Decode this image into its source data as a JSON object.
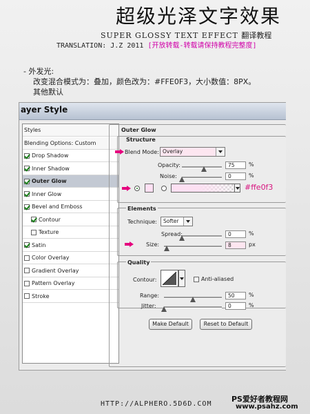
{
  "header": {
    "title_cn": "超级光泽文字效果",
    "title_en": "SUPER GLOSSY TEXT EFFECT",
    "title_en_suffix": "翻译教程",
    "translation": "TRANSLATION: J.Z",
    "year": "2011",
    "notice": "[开放转载-转载请保持教程完整度]"
  },
  "note": {
    "line1": "- 外发光:",
    "line2": "改变混合模式为：叠加，颜色改为：#FFE0F3，大小数值：8PX。",
    "line3": "其他默认"
  },
  "dialog": {
    "title": "ayer Style",
    "list": [
      {
        "label": "Styles",
        "checkbox": false,
        "checked": false,
        "indent": false,
        "selected": false,
        "header": true
      },
      {
        "label": "Blending Options: Custom",
        "checkbox": false,
        "checked": false,
        "indent": false,
        "selected": false,
        "header": true
      },
      {
        "label": "Drop Shadow",
        "checkbox": true,
        "checked": true,
        "indent": false,
        "selected": false
      },
      {
        "label": "Inner Shadow",
        "checkbox": true,
        "checked": true,
        "indent": false,
        "selected": false
      },
      {
        "label": "Outer Glow",
        "checkbox": true,
        "checked": true,
        "indent": false,
        "selected": true
      },
      {
        "label": "Inner Glow",
        "checkbox": true,
        "checked": true,
        "indent": false,
        "selected": false
      },
      {
        "label": "Bevel and Emboss",
        "checkbox": true,
        "checked": true,
        "indent": false,
        "selected": false
      },
      {
        "label": "Contour",
        "checkbox": true,
        "checked": true,
        "indent": true,
        "selected": false
      },
      {
        "label": "Texture",
        "checkbox": true,
        "checked": false,
        "indent": true,
        "selected": false
      },
      {
        "label": "Satin",
        "checkbox": true,
        "checked": true,
        "indent": false,
        "selected": false
      },
      {
        "label": "Color Overlay",
        "checkbox": true,
        "checked": false,
        "indent": false,
        "selected": false
      },
      {
        "label": "Gradient Overlay",
        "checkbox": true,
        "checked": false,
        "indent": false,
        "selected": false
      },
      {
        "label": "Pattern Overlay",
        "checkbox": true,
        "checked": false,
        "indent": false,
        "selected": false
      },
      {
        "label": "Stroke",
        "checkbox": true,
        "checked": false,
        "indent": false,
        "selected": false
      }
    ],
    "panel_title": "Outer Glow",
    "structure": {
      "title": "Structure",
      "blend_mode_label": "Blend Mode:",
      "blend_mode_value": "Overlay",
      "opacity_label": "Opacity:",
      "opacity_value": "75",
      "noise_label": "Noise:",
      "noise_value": "0",
      "percent": "%",
      "color_annotation": "#ffe0f3",
      "glow_color": "#ffe0f3"
    },
    "elements": {
      "title": "Elements",
      "technique_label": "Technique:",
      "technique_value": "Softer",
      "spread_label": "Spread:",
      "spread_value": "0",
      "size_label": "Size:",
      "size_value": "8",
      "px": "px",
      "percent": "%"
    },
    "quality": {
      "title": "Quality",
      "contour_label": "Contour:",
      "anti_aliased_label": "Anti-aliased",
      "range_label": "Range:",
      "range_value": "50",
      "jitter_label": "Jitter:",
      "jitter_value": "0",
      "percent": "%"
    },
    "buttons": {
      "make_default": "Make Default",
      "reset_default": "Reset to Default"
    }
  },
  "footer": {
    "url": "HTTP://ALPHERO.5D6D.COM",
    "watermark_line1": "PS爱好者教程网",
    "watermark_line2": "www.psahz.com"
  }
}
